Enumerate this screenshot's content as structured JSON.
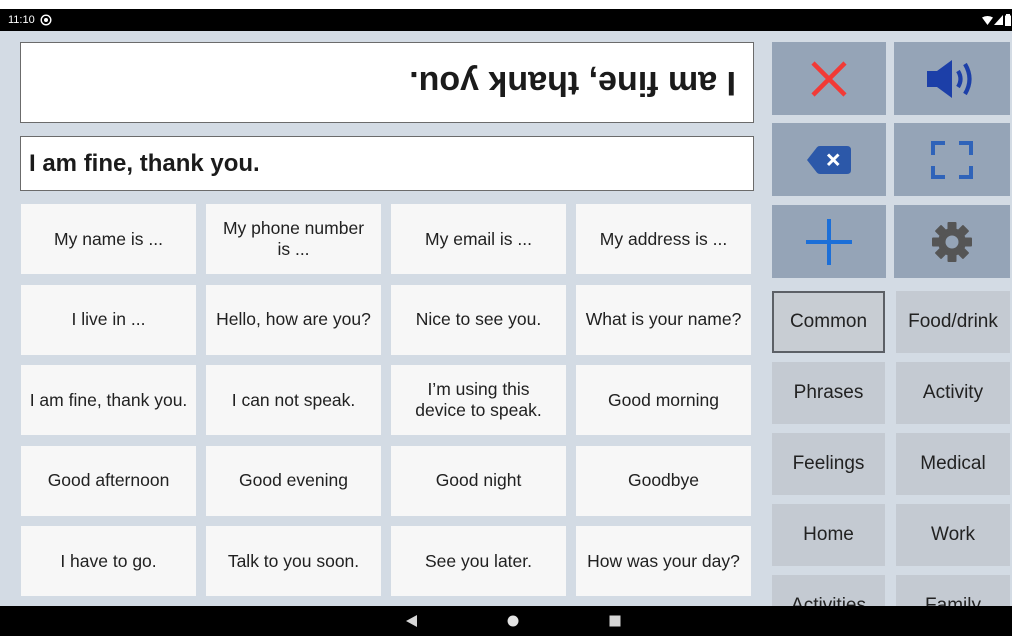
{
  "status_bar": {
    "time": "11:10",
    "notification_icon": "notification-icon",
    "wifi_icon": "wifi-icon",
    "signal_icon": "signal-icon",
    "battery_icon": "battery-icon"
  },
  "display": {
    "flipped_text": "I am fine, thank you.",
    "text": "I am fine, thank you."
  },
  "actions": {
    "clear": {
      "icon": "close-icon",
      "color": "#f23a36"
    },
    "speak": {
      "icon": "speaker-icon",
      "color": "#1c3fa8"
    },
    "backspace": {
      "icon": "backspace-icon",
      "color": "#2c58a9"
    },
    "fullscreen": {
      "icon": "fullscreen-icon",
      "color": "#2f63b9"
    },
    "add": {
      "icon": "plus-icon",
      "color": "#1c6fd8"
    },
    "settings": {
      "icon": "gear-icon",
      "color": "#555555"
    }
  },
  "phrases": [
    [
      "My name is ...",
      "My phone number is ...",
      "My email is ...",
      "My address is ..."
    ],
    [
      "I live in ...",
      "Hello, how are you?",
      "Nice to see you.",
      "What is your name?"
    ],
    [
      "I am fine, thank you.",
      "I can not speak.",
      "I’m using this device to speak.",
      "Good morning"
    ],
    [
      "Good afternoon",
      "Good evening",
      "Good night",
      "Goodbye"
    ],
    [
      "I have to go.",
      "Talk to you soon.",
      "See you later.",
      "How was your day?"
    ]
  ],
  "categories": [
    {
      "label": "Common",
      "selected": true
    },
    {
      "label": "Food/drink",
      "selected": false
    },
    {
      "label": "Phrases",
      "selected": false
    },
    {
      "label": "Activity",
      "selected": false
    },
    {
      "label": "Feelings",
      "selected": false
    },
    {
      "label": "Medical",
      "selected": false
    },
    {
      "label": "Home",
      "selected": false
    },
    {
      "label": "Work",
      "selected": false
    },
    {
      "label": "Activities",
      "selected": false
    },
    {
      "label": "Family",
      "selected": false
    }
  ],
  "navigation_bar": {
    "back_icon": "back-icon",
    "home_icon": "home-icon",
    "recents_icon": "recents-icon"
  },
  "colors": {
    "background": "#d3dbe4",
    "action_button": "#95a4b7",
    "phrase_button": "#f7f7f7",
    "category_button": "#c4cad2",
    "selected_border": "#5c6066",
    "display_border": "#6b6b6b"
  }
}
